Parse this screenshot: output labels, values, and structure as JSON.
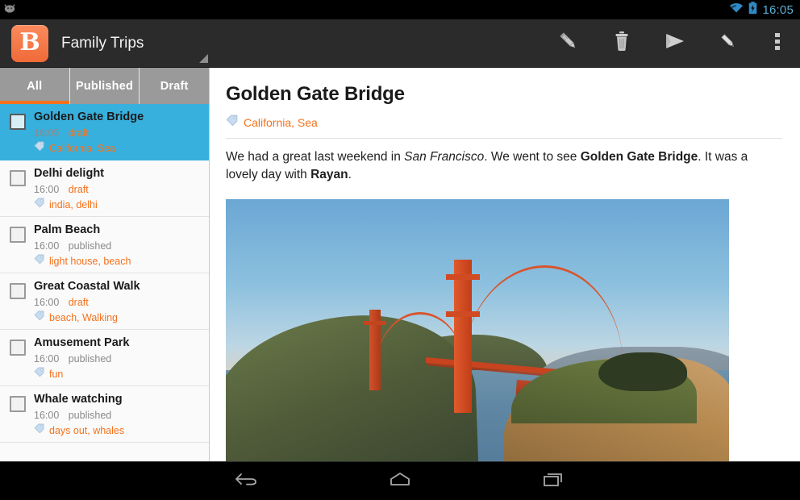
{
  "status_bar": {
    "notification_icon": "android-robot-icon",
    "wifi_icon": "wifi-icon",
    "battery_icon": "battery-charging-icon",
    "clock": "16:05",
    "clock_color": "#5badd4"
  },
  "action_bar": {
    "app_logo": "blogger-logo",
    "logo_letter": "B",
    "title": "Family Trips",
    "spinner_indicator": "dropdown-triangle-icon",
    "background_color": "#2b2b2b",
    "actions": [
      {
        "name": "edit-post-button",
        "icon": "pencil-icon",
        "label": "Edit"
      },
      {
        "name": "delete-post-button",
        "icon": "trash-icon",
        "label": "Delete"
      },
      {
        "name": "publish-post-button",
        "icon": "send-icon",
        "label": "Publish"
      },
      {
        "name": "compose-post-button",
        "icon": "pencil-small-icon",
        "label": "Compose"
      },
      {
        "name": "overflow-menu-button",
        "icon": "more-vertical-icon",
        "label": "More options"
      }
    ]
  },
  "sidebar": {
    "tabs": [
      {
        "label": "All",
        "active": true
      },
      {
        "label": "Published",
        "active": false
      },
      {
        "label": "Draft",
        "active": false
      }
    ],
    "active_tab_underline_color": "#f4721d",
    "tab_background_color": "#9a9a9a",
    "selected_row_color": "#38b0dd",
    "posts": [
      {
        "title": "Golden Gate Bridge",
        "time": "16:05",
        "status": "draft",
        "tags": "California, Sea",
        "selected": true
      },
      {
        "title": "Delhi delight",
        "time": "16:00",
        "status": "draft",
        "tags": "india, delhi",
        "selected": false
      },
      {
        "title": "Palm Beach",
        "time": "16:00",
        "status": "published",
        "tags": "light house, beach",
        "selected": false
      },
      {
        "title": "Great Coastal Walk",
        "time": "16:00",
        "status": "draft",
        "tags": "beach, Walking",
        "selected": false
      },
      {
        "title": "Amusement Park",
        "time": "16:00",
        "status": "published",
        "tags": "fun",
        "selected": false
      },
      {
        "title": "Whale watching",
        "time": "16:00",
        "status": "published",
        "tags": "days out, whales",
        "selected": false
      }
    ]
  },
  "detail": {
    "title": "Golden Gate Bridge",
    "tag_icon": "tag-icon",
    "tags": "California, Sea",
    "body": {
      "segment_1": "We had a great last weekend in ",
      "italic_1": "San Francisco",
      "segment_2": ". We went to see ",
      "bold_1": "Golden Gate Bridge",
      "segment_3": ". It was a lovely day with ",
      "bold_2": "Rayan",
      "segment_4": "."
    },
    "image_alt": "golden-gate-bridge-photo",
    "accent_color": "#f4721d"
  },
  "nav_bar": {
    "buttons": [
      {
        "name": "nav-back-button",
        "icon": "back-arrow-icon"
      },
      {
        "name": "nav-home-button",
        "icon": "home-icon"
      },
      {
        "name": "nav-recents-button",
        "icon": "recents-icon"
      }
    ]
  }
}
